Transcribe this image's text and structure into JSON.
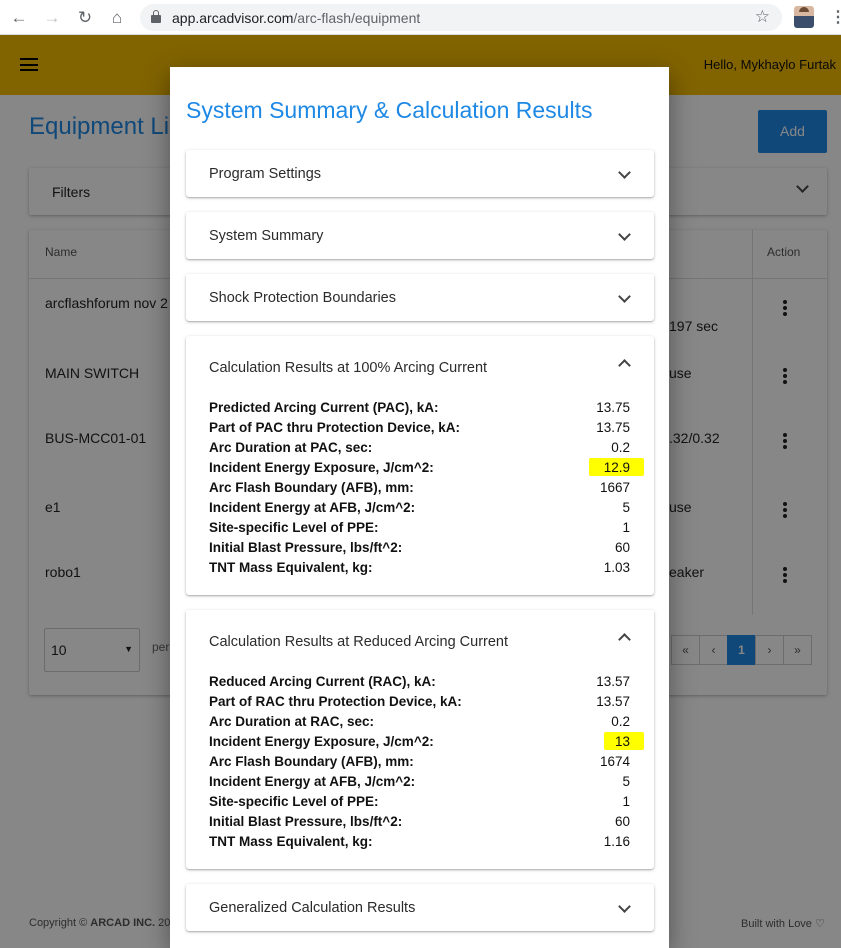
{
  "browser": {
    "url_host": "app.arcadvisor.com",
    "url_path": "/arc-flash/equipment"
  },
  "header": {
    "greeting": "Hello, Mykhaylo Furtak"
  },
  "page": {
    "title": "Equipment Lis",
    "add_label": "Add",
    "filters_label": "Filters",
    "columns": {
      "name": "Name",
      "action": "Action"
    },
    "rows": [
      {
        "name": "arcflashforum nov 2",
        "right": "197 sec"
      },
      {
        "name": "MAIN SWITCH",
        "right": "use"
      },
      {
        "name": "BUS-MCC01-01",
        "right": ".32/0.32"
      },
      {
        "name": "e1",
        "right": "use"
      },
      {
        "name": "robo1",
        "right": "eaker"
      }
    ],
    "per_page_value": "10",
    "per_page_label": "per",
    "pager": [
      "«",
      "‹",
      "1",
      "›",
      "»"
    ],
    "footer_left_prefix": "Copyright © ",
    "footer_left_brand": "ARCAD INC.",
    "footer_left_suffix": " 20",
    "footer_right": "Built with Love ♡"
  },
  "dialog": {
    "title": "System Summary & Calculation Results",
    "panels": {
      "program_settings": "Program Settings",
      "system_summary": "System Summary",
      "shock_boundaries": "Shock Protection Boundaries",
      "full_current": "Calculation Results at 100% Arcing Current",
      "reduced_current": "Calculation Results at Reduced Arcing Current",
      "generalized": "Generalized Calculation Results"
    },
    "full_results": [
      {
        "label": "Predicted Arcing Current (PAC), kA:",
        "value": "13.75"
      },
      {
        "label": "Part of PAC thru Protection Device, kA:",
        "value": "13.75"
      },
      {
        "label": "Arc Duration at PAC, sec:",
        "value": "0.2"
      },
      {
        "label": "Incident Energy Exposure, J/cm^2:",
        "value": "12.9"
      },
      {
        "label": "Arc Flash Boundary (AFB), mm:",
        "value": "1667"
      },
      {
        "label": "Incident Energy at AFB, J/cm^2:",
        "value": "5"
      },
      {
        "label": "Site-specific Level of PPE:",
        "value": "1"
      },
      {
        "label": "Initial Blast Pressure, lbs/ft^2:",
        "value": "60"
      },
      {
        "label": "TNT Mass Equivalent, kg:",
        "value": "1.03"
      }
    ],
    "reduced_results": [
      {
        "label": "Reduced Arcing Current (RAC), kA:",
        "value": "13.57"
      },
      {
        "label": "Part of RAC thru Protection Device, kA:",
        "value": "13.57"
      },
      {
        "label": "Arc Duration at RAC, sec:",
        "value": "0.2"
      },
      {
        "label": "Incident Energy Exposure, J/cm^2:",
        "value": "13"
      },
      {
        "label": "Arc Flash Boundary (AFB), mm:",
        "value": "1674"
      },
      {
        "label": "Incident Energy at AFB, J/cm^2:",
        "value": "5"
      },
      {
        "label": "Site-specific Level of PPE:",
        "value": "1"
      },
      {
        "label": "Initial Blast Pressure, lbs/ft^2:",
        "value": "60"
      },
      {
        "label": "TNT Mass Equivalent, kg:",
        "value": "1.16"
      }
    ]
  },
  "colors": {
    "brand_yellow": "#f4bb00",
    "accent_blue": "#1e88e5",
    "highlight": "#ffff00"
  }
}
